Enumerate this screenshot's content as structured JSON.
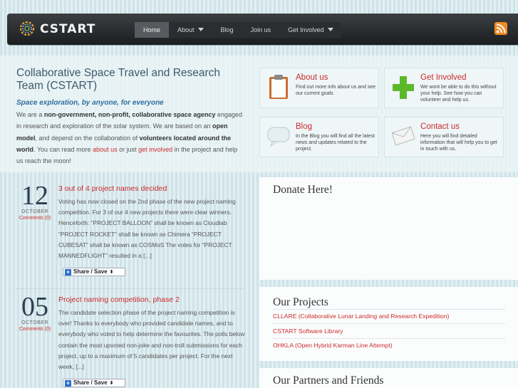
{
  "header": {
    "logo_text": "CSTART",
    "nav": [
      {
        "label": "Home",
        "active": true,
        "has_caret": false
      },
      {
        "label": "About",
        "active": false,
        "has_caret": true
      },
      {
        "label": "Blog",
        "active": false,
        "has_caret": false
      },
      {
        "label": "Join us",
        "active": false,
        "has_caret": false
      },
      {
        "label": "Get Involved",
        "active": false,
        "has_caret": true
      }
    ],
    "rss_icon": "rss-icon"
  },
  "intro": {
    "title": "Collaborative Space Travel and Research Team (CSTART)",
    "tagline": "Space exploration, by anyone, for everyone",
    "body": {
      "p1": "We are a ",
      "b1": "non-government, non-profit, collaborative space agency",
      "p2": " engaged in research and exploration of the solar system. We are based on an ",
      "b2": "open model",
      "p3": ", and depend on the collaboration of ",
      "b3": "volunteers located around the world",
      "p4": ". You can read more ",
      "link1": "about us",
      "p5": " or just ",
      "link2": "get involved",
      "p6": " in the project and help us reach the moon!"
    }
  },
  "cards": {
    "about": {
      "title": "About us",
      "desc": "Find out more info about us and see our current goals.",
      "icon": "clipboard-icon"
    },
    "involved": {
      "title": "Get Involved",
      "desc": "We wont be able to do this without your help. See how you can volunteer and help us.",
      "icon": "plus-icon"
    },
    "blog": {
      "title": "Blog",
      "desc": "In the Blog you will find all the latest news and updates related to the project.",
      "icon": "speech-bubble-icon"
    },
    "contact": {
      "title": "Contact us",
      "desc": "Here you will find detailed information that will help you to get in touch with us.",
      "icon": "envelope-icon"
    }
  },
  "posts": [
    {
      "day": "12",
      "month": "OCTOBER",
      "comments": "Comments (0)",
      "title": "3 out of 4 project names decided",
      "excerpt": "Voting has now closed on the 2nd phase of the new project naming competition.  For 3 of our 4 new projects there were clear winners.  Henceforth: “PROJECT BALLOON” shall be known as Cloudlab “PROJECT ROCKET” shall be known as Chimera “PROJECT CUBESAT” shall be known as COSMoS The votes for “PROJECT MANNEDFLIGHT” resulted in a [...]",
      "share": "Share / Save"
    },
    {
      "day": "05",
      "month": "OCTOBER",
      "comments": "Comments (0)",
      "title": "Project naming competition, phase 2",
      "excerpt": "The candidate selection phase of the project naming competition is over!  Thanks to everybody who provided candidate names, and to everybody who voted to help determine the favourites. The polls below contain the most upvoted non-joke and non-troll submissions for each project, up to a maximum of 5 candidates per project.  For the next week, [...]",
      "share": "Share / Save"
    }
  ],
  "sidebar": {
    "donate_title": "Donate Here!",
    "projects_title": "Our Projects",
    "projects": [
      "CLLARE (Collaborative Lunar Landing and Research Expedition)",
      "CSTART Software Library",
      "OHKLA (Open Hybrid Karman Line Attempt)"
    ],
    "partners_title": "Our Partners and Friends"
  },
  "colors": {
    "accent": "#cc2b2b",
    "header_bg": "#1c1e20",
    "tagline": "#2e6da0"
  }
}
